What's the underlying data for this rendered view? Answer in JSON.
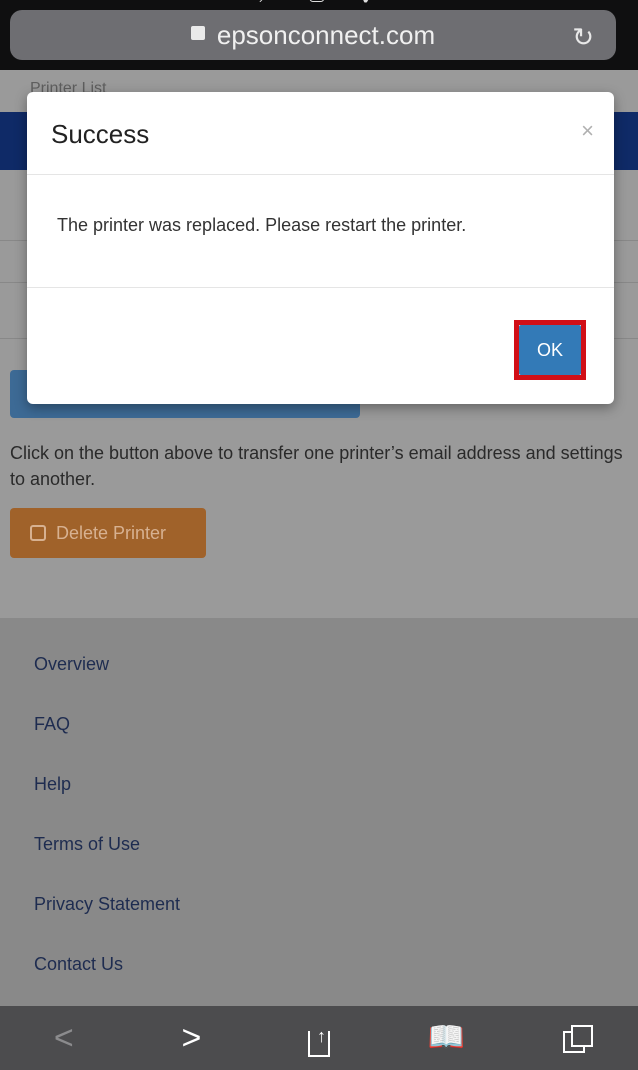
{
  "browser": {
    "url": "epsonconnect.com",
    "icons": [
      "search-icon",
      "clipboard-icon",
      "checkmark-icon",
      "lock-icon",
      "reload-icon"
    ]
  },
  "page": {
    "breadcrumb": "Printer List",
    "instruction": "Click on the button above to transfer one printer’s email address and settings to another.",
    "delete_button": "Delete Printer"
  },
  "footer": {
    "links": [
      "Overview",
      "FAQ",
      "Help",
      "Terms of Use",
      "Privacy Statement",
      "Contact Us"
    ]
  },
  "modal": {
    "title": "Success",
    "close_symbol": "×",
    "message": "The printer was replaced. Please restart the printer.",
    "ok_label": "OK"
  },
  "toolbar": {
    "back_symbol": "<",
    "forward_symbol": ">",
    "icons": [
      "back-icon",
      "forward-icon",
      "share-icon",
      "bookmarks-icon",
      "tabs-icon"
    ]
  },
  "colors": {
    "modal_button": "#337ab7",
    "highlight_frame": "#d10f17",
    "delete_button": "#a0622a",
    "header_band": "#0f2a67"
  }
}
